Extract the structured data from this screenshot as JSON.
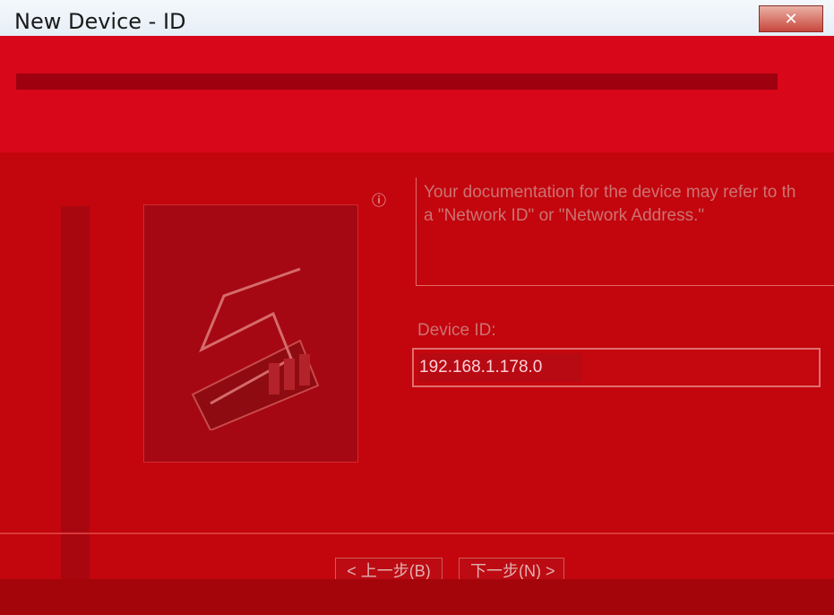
{
  "window": {
    "title": "New Device - ID"
  },
  "description": {
    "lines": [
      "Your documentation for the device may refer to th",
      "a \"Network ID\" or \"Network Address.\""
    ]
  },
  "device_id": {
    "label": "Device ID:",
    "value": "192.168.1.178.0"
  },
  "buttons": {
    "back_label": "< 上一步(B)",
    "next_label": "下一步(N) >"
  },
  "colors": {
    "window_bg": "#c3050d",
    "header_band": "#d8071a",
    "footer_band": "#a3050b"
  }
}
